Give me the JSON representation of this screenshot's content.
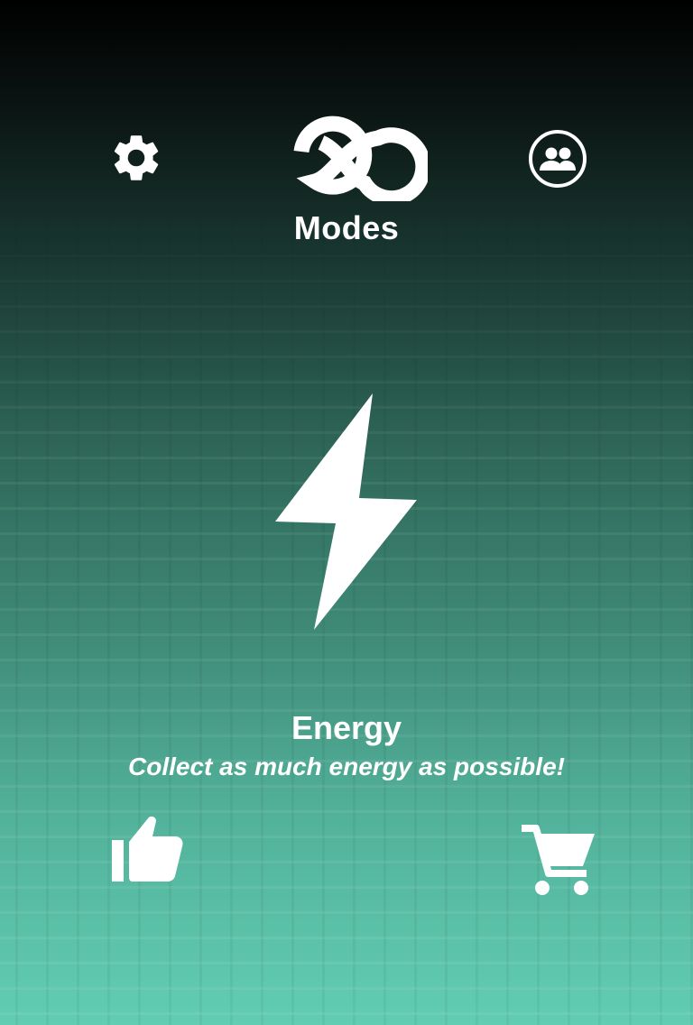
{
  "header": {
    "modes_label": "Modes",
    "settings_icon": "gear-icon",
    "modes_icon": "infinity-icon",
    "friends_icon": "people-circle-icon"
  },
  "mode": {
    "icon": "lightning-bolt-icon",
    "name": "Energy",
    "description": "Collect as much energy as possible!"
  },
  "footer": {
    "like_icon": "thumbs-up-icon",
    "shop_icon": "shopping-cart-icon"
  },
  "colors": {
    "gradient_top": "#000000",
    "gradient_bottom": "#62cdb3",
    "foreground": "#ffffff"
  }
}
